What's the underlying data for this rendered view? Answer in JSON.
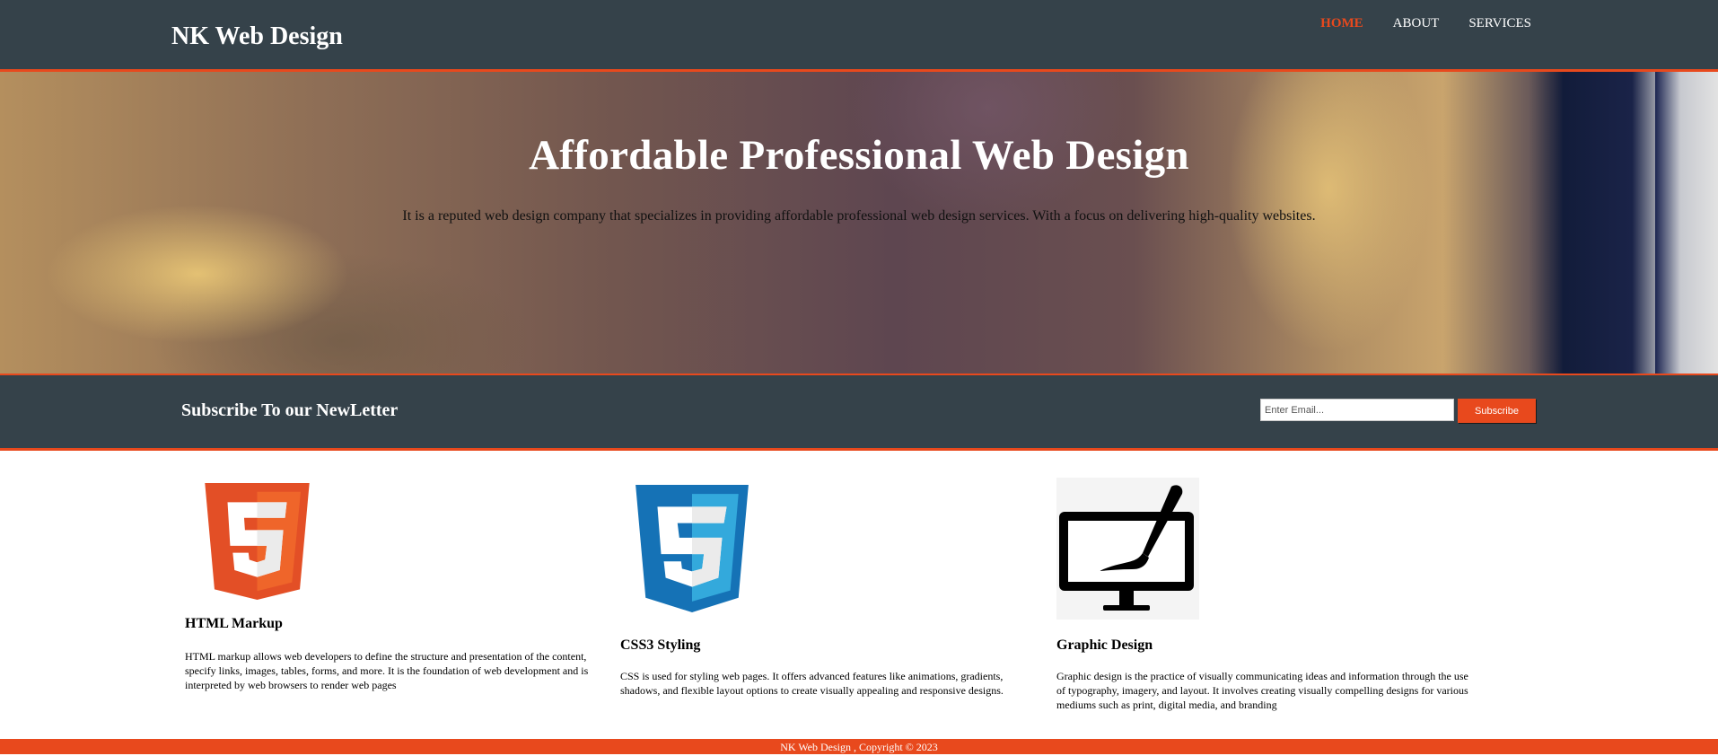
{
  "header": {
    "brand": "NK Web Design",
    "nav": [
      {
        "label": "HOME",
        "active": true
      },
      {
        "label": "ABOUT",
        "active": false
      },
      {
        "label": "SERVICES",
        "active": false
      }
    ]
  },
  "hero": {
    "title": "Affordable Professional Web Design",
    "subtitle": "It is a reputed web design company that specializes in providing affordable professional web design services. With a focus on delivering high-quality websites."
  },
  "newsletter": {
    "heading": "Subscribe To our NewLetter",
    "email_placeholder": "Enter Email...",
    "button_label": "Subscribe"
  },
  "boxes": [
    {
      "icon": "html5-icon",
      "title": "HTML Markup",
      "text": "HTML markup allows web developers to define the structure and presentation of the content, specify links, images, tables, forms, and more. It is the foundation of web development and is interpreted by web browsers to render web pages"
    },
    {
      "icon": "css3-icon",
      "title": "CSS3 Styling",
      "text": "CSS is used for styling web pages. It offers advanced features like animations, gradients, shadows, and flexible layout options to create visually appealing and responsive designs."
    },
    {
      "icon": "monitor-brush-icon",
      "title": "Graphic Design",
      "text": "Graphic design is the practice of visually communicating ideas and information through the use of typography, imagery, and layout. It involves creating visually compelling designs for various mediums such as print, digital media, and branding"
    }
  ],
  "footer": {
    "text": "NK Web Design , Copyright © 2023"
  },
  "colors": {
    "dark": "#35424a",
    "accent": "#e8491d",
    "white": "#ffffff"
  }
}
